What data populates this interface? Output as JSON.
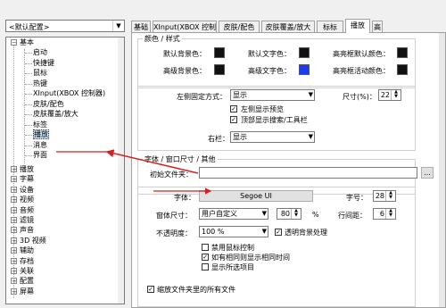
{
  "profile_select": {
    "value": "<默认配置>"
  },
  "tree": {
    "root_label": "基本",
    "children": [
      "启动",
      "快捷键",
      "鼠标",
      "热键",
      "XInput(XBOX 控制器)",
      "皮肤/配色",
      "皮肤覆盖/放大",
      "标签",
      "播放",
      "消息",
      "界面"
    ],
    "selected": "播放",
    "others": [
      "播放",
      "字幕",
      "设备",
      "视频",
      "音频",
      "滤镜",
      "声音",
      "3D 视频",
      "辅助",
      "存档",
      "关联",
      "配置",
      "屏幕"
    ]
  },
  "tabs": [
    "基础",
    "XInput(XBOX 控制器)",
    "皮肤/配色",
    "皮肤覆盖/放大",
    "标标",
    "播放",
    "高"
  ],
  "active_tab": "播放",
  "colors_group": {
    "title": "颜色 / 样式",
    "rows": [
      [
        "默认背景色：",
        "默认文字色：",
        "高亮框默认颜色："
      ],
      [
        "高级背景色：",
        "高级文字色：",
        "高亮框活动颜色："
      ]
    ],
    "swatches": [
      "#111111",
      "#111111",
      "#111111",
      "#111111",
      "#1a3cf2",
      "#111111"
    ]
  },
  "layout": {
    "left_fixed_label": "左侧固定方式：",
    "left_fixed_value": "显示",
    "size_label": "尺寸(%)：",
    "size_value": "22",
    "check1": "左侧显示预览",
    "check2": "顶部显示搜索/工具栏",
    "right_bar_label": "右栏：",
    "right_bar_value": "显示"
  },
  "font_group": {
    "title": "字体 / 窗口尺寸 / 其他",
    "init_folder_label": "初始文件夹：",
    "browse": "...",
    "font_label": "字体：",
    "font_button": "Segoe UI",
    "font_size_label": "字号：",
    "font_size_value": "28",
    "window_size_label": "窗体尺寸：",
    "window_size_value": "用户自定义",
    "window_pct_value": "80",
    "pct": "%",
    "line_spacing_label": "行间距：",
    "line_spacing_value": "6",
    "opacity_label": "不透明度：",
    "opacity_value": "100 %",
    "transparent_bg": "透明背景处理",
    "cb_disable_mouse": "禁用鼠标控制",
    "cb_show_time": "如有相同则显示相同时间",
    "cb_show_select": "显示所选项目",
    "cb_scale_all": "缩放文件夹里的所有文件"
  }
}
